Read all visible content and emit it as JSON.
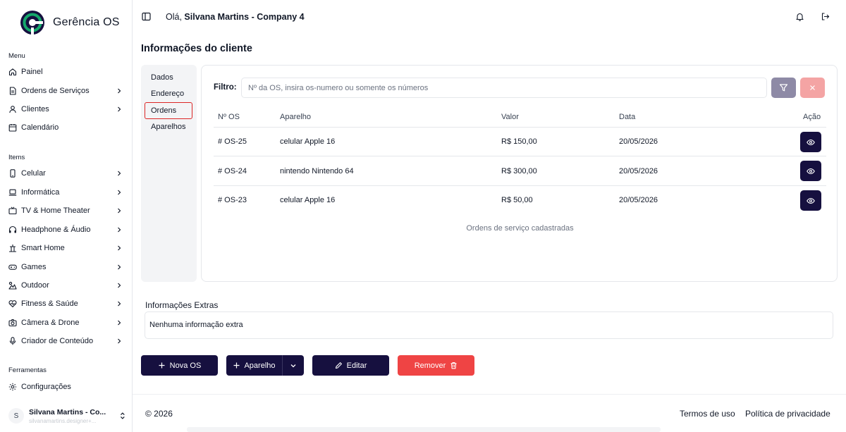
{
  "app": {
    "name": "Gerência OS"
  },
  "sidebar": {
    "menu_label": "Menu",
    "menu_items": [
      {
        "label": "Painel",
        "icon": "home-icon",
        "has_submenu": false
      },
      {
        "label": "Ordens de Serviços",
        "icon": "document-icon",
        "has_submenu": true
      },
      {
        "label": "Clientes",
        "icon": "user-icon",
        "has_submenu": true
      },
      {
        "label": "Calendário",
        "icon": "calendar-icon",
        "has_submenu": false
      }
    ],
    "items_label": "Items",
    "items": [
      {
        "label": "Celular",
        "icon": "smartphone-icon",
        "has_submenu": true
      },
      {
        "label": "Informática",
        "icon": "laptop-icon",
        "has_submenu": true
      },
      {
        "label": "TV & Home Theater",
        "icon": "tv-icon",
        "has_submenu": true
      },
      {
        "label": "Headphone & Áudio",
        "icon": "headphones-icon",
        "has_submenu": true
      },
      {
        "label": "Smart Home",
        "icon": "smart-home-icon",
        "has_submenu": true
      },
      {
        "label": "Games",
        "icon": "gamepad-icon",
        "has_submenu": true
      },
      {
        "label": "Outdoor",
        "icon": "outdoor-icon",
        "has_submenu": true
      },
      {
        "label": "Fitness & Saúde",
        "icon": "heart-pulse-icon",
        "has_submenu": true
      },
      {
        "label": "Câmera & Drone",
        "icon": "camera-icon",
        "has_submenu": true
      },
      {
        "label": "Criador de Conteúdo",
        "icon": "microphone-icon",
        "has_submenu": true
      }
    ],
    "tools_label": "Ferramentas",
    "tools": [
      {
        "label": "Configurações",
        "icon": "gear-icon",
        "has_submenu": false
      }
    ],
    "user": {
      "initial": "S",
      "name": "Silvana Martins - Co...",
      "email": "silvanamartins.designer+..."
    }
  },
  "header": {
    "greeting_prefix": "Olá,",
    "greeting_name": "Silvana Martins - Company 4"
  },
  "page": {
    "title": "Informações do cliente",
    "tabs": [
      {
        "label": "Dados",
        "selected": false
      },
      {
        "label": "Endereço",
        "selected": false
      },
      {
        "label": "Ordens",
        "selected": true
      },
      {
        "label": "Aparelhos",
        "selected": false
      }
    ]
  },
  "orders": {
    "filter_label": "Filtro:",
    "filter_value": "",
    "filter_placeholder": "Nº da OS, insira os-numero ou somente os números",
    "columns": [
      "Nº OS",
      "Aparelho",
      "Valor",
      "Data",
      "Ação"
    ],
    "rows": [
      {
        "os": "# OS-25",
        "device": "celular Apple 16",
        "value": "R$ 150,00",
        "date": "20/05/2026"
      },
      {
        "os": "# OS-24",
        "device": "nintendo Nintendo 64",
        "value": "R$ 300,00",
        "date": "20/05/2026"
      },
      {
        "os": "# OS-23",
        "device": "celular Apple 16",
        "value": "R$ 50,00",
        "date": "20/05/2026"
      }
    ],
    "caption": "Ordens de serviço cadastradas"
  },
  "extras": {
    "title": "Informações Extras",
    "text": "Nenhuma informação extra"
  },
  "actions": {
    "new_os": "Nova OS",
    "device": "Aparelho",
    "edit": "Editar",
    "remove": "Remover"
  },
  "footer": {
    "copyright": "© 2026",
    "terms": "Termos de uso",
    "privacy": "Política de privacidade"
  },
  "colors": {
    "primary": "#16103f",
    "danger": "#ef4444",
    "filter_button": "#8e8aa6",
    "clear_button": "#f4a4a4",
    "logo_green": "#15a86b"
  }
}
